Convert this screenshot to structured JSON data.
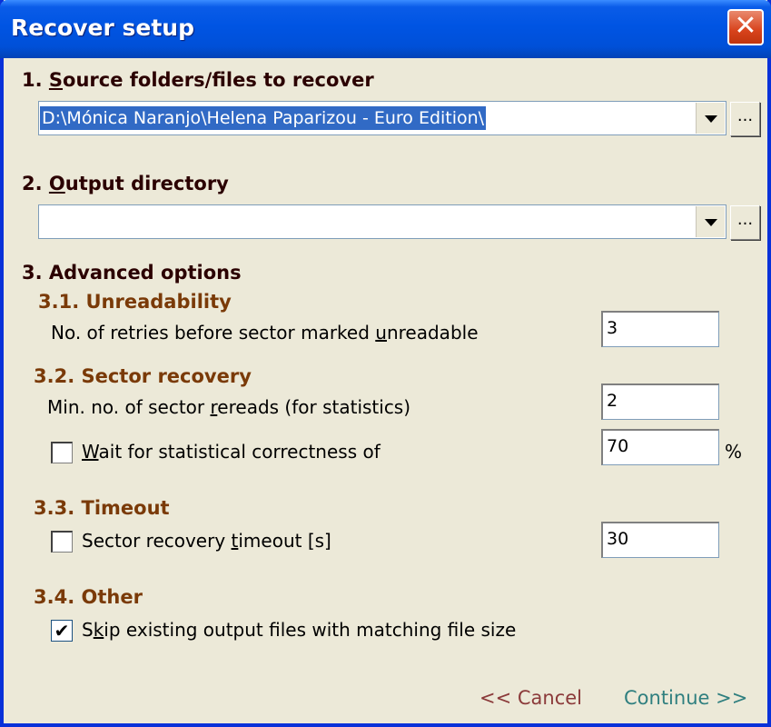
{
  "window": {
    "title": "Recover setup"
  },
  "source": {
    "heading_prefix": "1. ",
    "heading_u": "S",
    "heading_rest": "ource folders/files to recover",
    "value": "D:\\Mónica Naranjo\\Helena Paparizou - Euro Edition\\",
    "browse_label": "..."
  },
  "output": {
    "heading_prefix": "2. ",
    "heading_u": "O",
    "heading_rest": "utput directory",
    "value": "",
    "browse_label": "..."
  },
  "advanced": {
    "heading": "3. Advanced options",
    "unreadability": {
      "heading": "3.1. Unreadability",
      "label_a": "No. of retries before sector marked ",
      "label_u": "u",
      "label_b": "nreadable",
      "value": "3"
    },
    "sector_recovery": {
      "heading": "3.2. Sector recovery",
      "rereads_label_a": "Min. no. of sector ",
      "rereads_label_u": "r",
      "rereads_label_b": "ereads (for statistics)",
      "rereads_value": "2",
      "wait_label_u": "W",
      "wait_label_b": "ait for statistical correctness of",
      "wait_checked": false,
      "wait_value": "70",
      "wait_unit": "%"
    },
    "timeout": {
      "heading": "3.3. Timeout",
      "label_a": "Sector recovery ",
      "label_u": "t",
      "label_b": "imeout [s]",
      "checked": false,
      "value": "30"
    },
    "other": {
      "heading": "3.4. Other",
      "label_a": "S",
      "label_u": "k",
      "label_b": "ip existing output files with matching file size",
      "checked": true,
      "check_glyph": "✔"
    }
  },
  "buttons": {
    "cancel": "<< Cancel",
    "continue": "Continue >>"
  },
  "colors": {
    "title_bar": "#0054e3",
    "cancel_text": "#8b3a3a",
    "continue_text": "#2f7f7f"
  }
}
